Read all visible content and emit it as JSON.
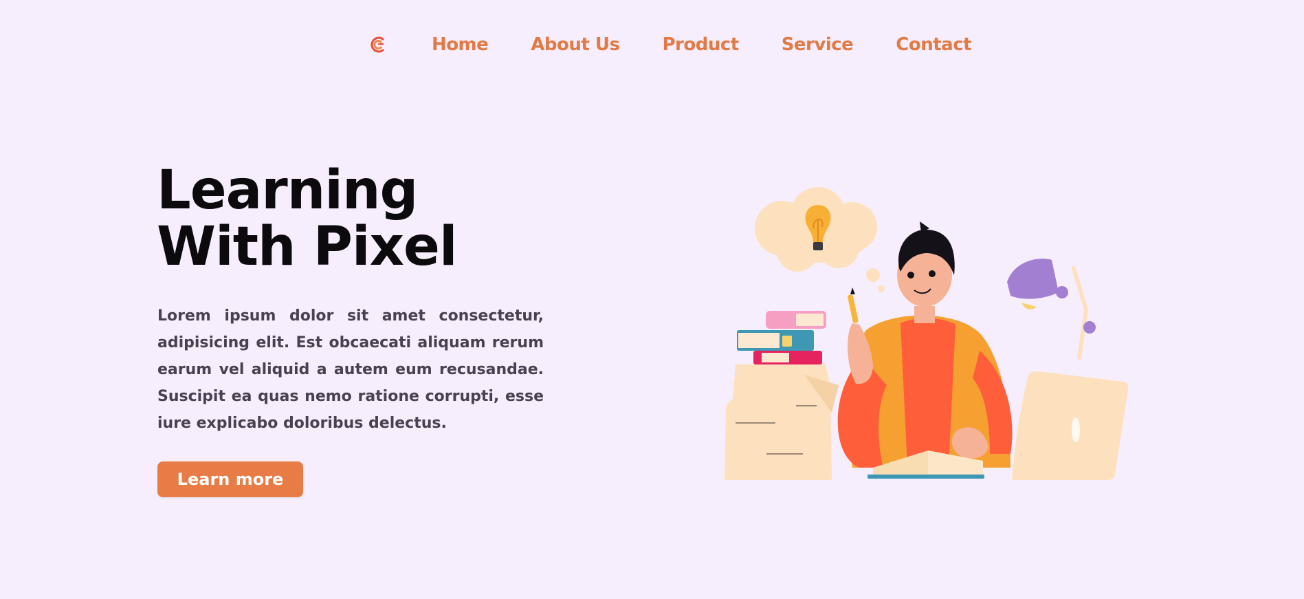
{
  "nav": {
    "logo_icon": "brand-logo-icon",
    "items": [
      {
        "label": "Home"
      },
      {
        "label": "About Us"
      },
      {
        "label": "Product"
      },
      {
        "label": "Service"
      },
      {
        "label": "Contact"
      }
    ]
  },
  "hero": {
    "title_line1": "Learning",
    "title_line2": "With Pixel",
    "description": "Lorem ipsum dolor sit amet consectetur, adipisicing elit. Est obcaecati aliquam rerum earum vel aliquid a autem eum recusandae. Suscipit ea quas nemo ratione corrupti, esse iure explicabo doloribus delectus.",
    "cta_label": "Learn more"
  },
  "colors": {
    "background": "#f6eefc",
    "accent": "#e77c46",
    "title": "#0c0a0d",
    "text": "#4a4150"
  }
}
